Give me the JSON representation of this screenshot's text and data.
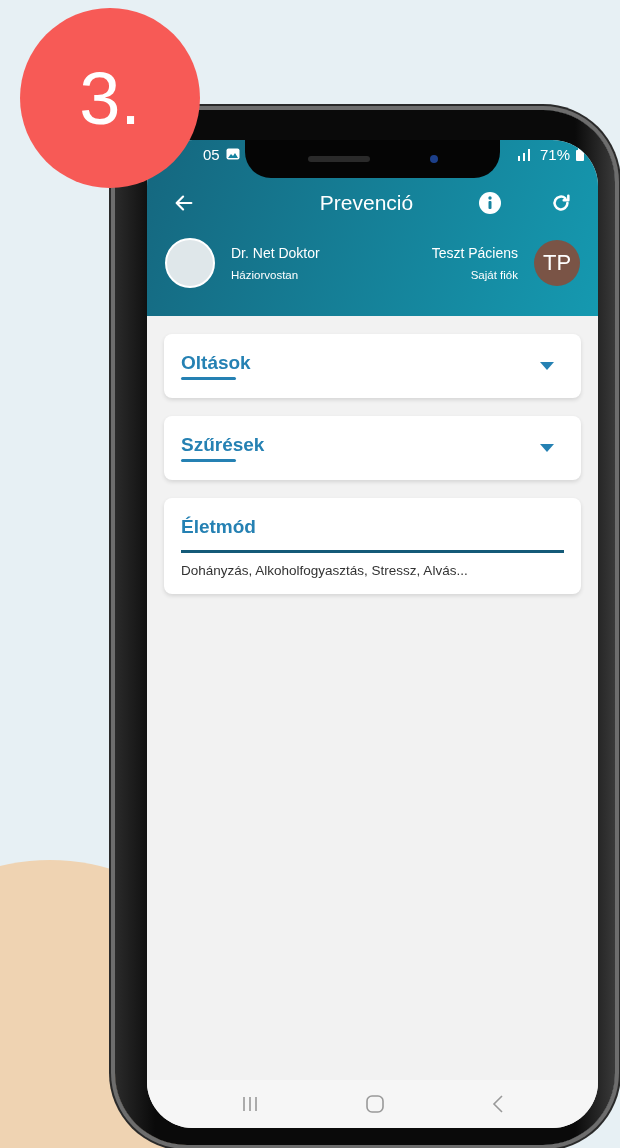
{
  "badge": {
    "text": "3."
  },
  "status_bar": {
    "time": "05",
    "battery": "71%"
  },
  "app_bar": {
    "title": "Prevenció"
  },
  "doctor": {
    "name": "Dr. Net Doktor",
    "role": "Háziorvostan"
  },
  "patient": {
    "name": "Teszt Páciens",
    "account": "Saját fiók",
    "initials": "TP"
  },
  "sections": [
    {
      "kind": "collapsible",
      "title": "Oltások",
      "expanded": false
    },
    {
      "kind": "collapsible",
      "title": "Szűrések",
      "expanded": false
    },
    {
      "kind": "summary",
      "title": "Életmód",
      "summary": "Dohányzás, Alkoholfogyasztás, Stressz, Alvás..."
    }
  ]
}
